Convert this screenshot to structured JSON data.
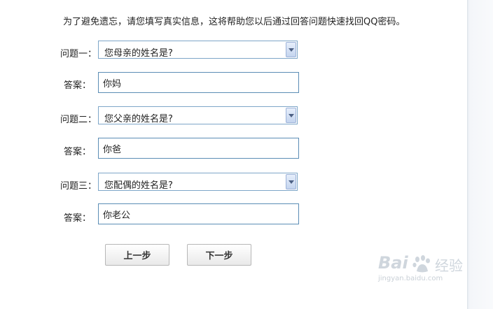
{
  "intro_text": "为了避免遗忘，请您填写真实信息，这将帮助您以后通过回答问题快速找回QQ密码。",
  "questions": [
    {
      "label": "问题一：",
      "selected": "您母亲的姓名是?",
      "answer_label": "答案：",
      "answer": "你妈"
    },
    {
      "label": "问题二：",
      "selected": "您父亲的姓名是?",
      "answer_label": "答案：",
      "answer": "你爸"
    },
    {
      "label": "问题三：",
      "selected": "您配偶的姓名是?",
      "answer_label": "答案：",
      "answer": "你老公"
    }
  ],
  "buttons": {
    "prev": "上一步",
    "next": "下一步"
  },
  "watermark": {
    "brand_left": "Bai",
    "brand_right": "du",
    "brand_cn": "经验",
    "url": "jingyan.baidu.com"
  },
  "colors": {
    "select_border": "#7ea6c8",
    "input_border": "#5b8db5",
    "arrow_fill": "#c4d4ee"
  }
}
